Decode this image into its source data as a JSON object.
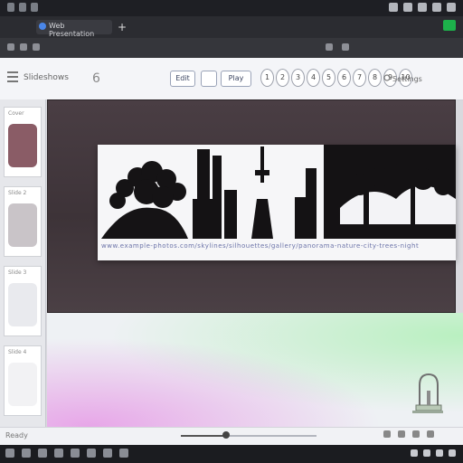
{
  "browser": {
    "tab_title": "Web Presentation",
    "new_tab_symbol": "+"
  },
  "toolbar": {
    "app_title": "Slideshows",
    "page_counter": "6",
    "btn_save": "Edit",
    "btn_copy": "",
    "btn_play": "Play",
    "circles": [
      "1",
      "2",
      "3",
      "4",
      "5",
      "6",
      "7",
      "8",
      "9",
      "10"
    ],
    "settings_label": "Settings"
  },
  "sidebar": {
    "thumbs": [
      {
        "label": "Cover",
        "color": "#8a5c66"
      },
      {
        "label": "Slide 2",
        "color": "#c9c4c8"
      },
      {
        "label": "Slide 3",
        "color": "#e9eaee"
      },
      {
        "label": "Slide 4",
        "color": "#f2f2f4"
      }
    ]
  },
  "canvas": {
    "caption": "www.example-photos.com/skylines/silhouettes/gallery/panorama-nature-city-trees-night"
  },
  "status": {
    "left_label": "Ready",
    "zoom": 0.33
  },
  "colors": {
    "accent_green": "#1db14b",
    "taskbar_red": "#e0453a"
  }
}
